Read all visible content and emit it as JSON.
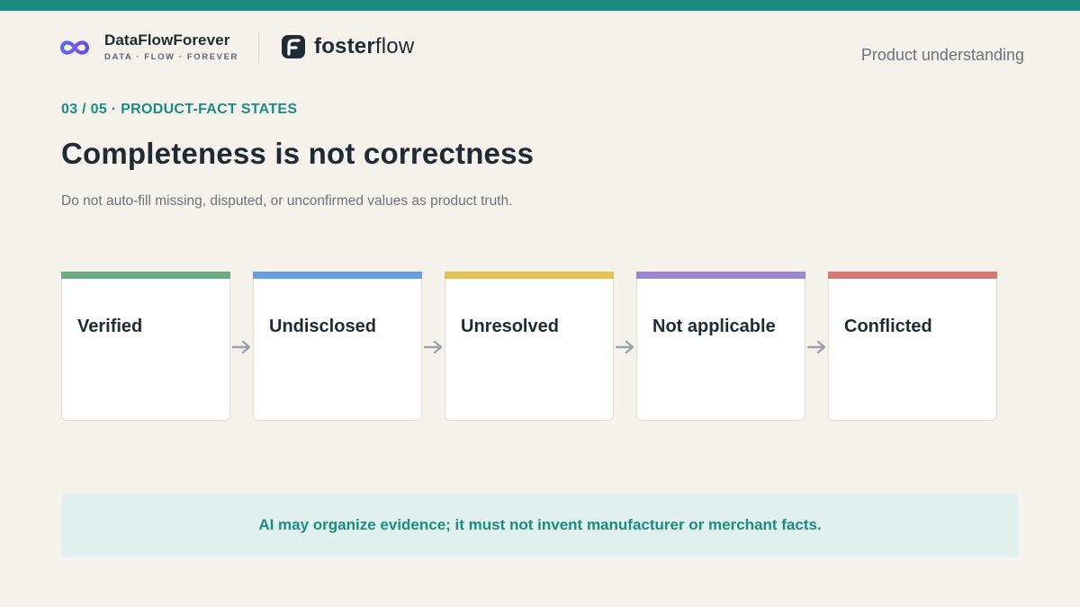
{
  "colors": {
    "accent": "#1b8c80",
    "background": "#f5f2ec",
    "card": "#ffffff",
    "callout_bg": "#e0f0ec",
    "arrow": "#9aa3ab"
  },
  "header": {
    "brand": {
      "icon": "infinity-logo-icon",
      "name": "DataFlowForever",
      "tagline": "DATA · FLOW · FOREVER"
    },
    "partner": {
      "icon": "fosterflow-logo-icon",
      "name_bold": "foster",
      "name_light": "flow"
    },
    "section_label": "Product understanding"
  },
  "slide": {
    "eyebrow": "03 / 05 · PRODUCT-FACT STATES",
    "title": "Completeness is not correctness",
    "subtitle": "Do not auto-fill missing, disputed, or unconfirmed values as product truth."
  },
  "states": [
    {
      "label": "Verified",
      "color": "#6bab83"
    },
    {
      "label": "Undisclosed",
      "color": "#6a9de0"
    },
    {
      "label": "Unresolved",
      "color": "#e4c350"
    },
    {
      "label": "Not applicable",
      "color": "#9d85d3"
    },
    {
      "label": "Conflicted",
      "color": "#d9786c"
    }
  ],
  "arrows": {
    "icon": "arrow-right-icon",
    "count": 4
  },
  "callout": {
    "text": "AI may organize evidence; it must not invent manufacturer or merchant facts."
  }
}
